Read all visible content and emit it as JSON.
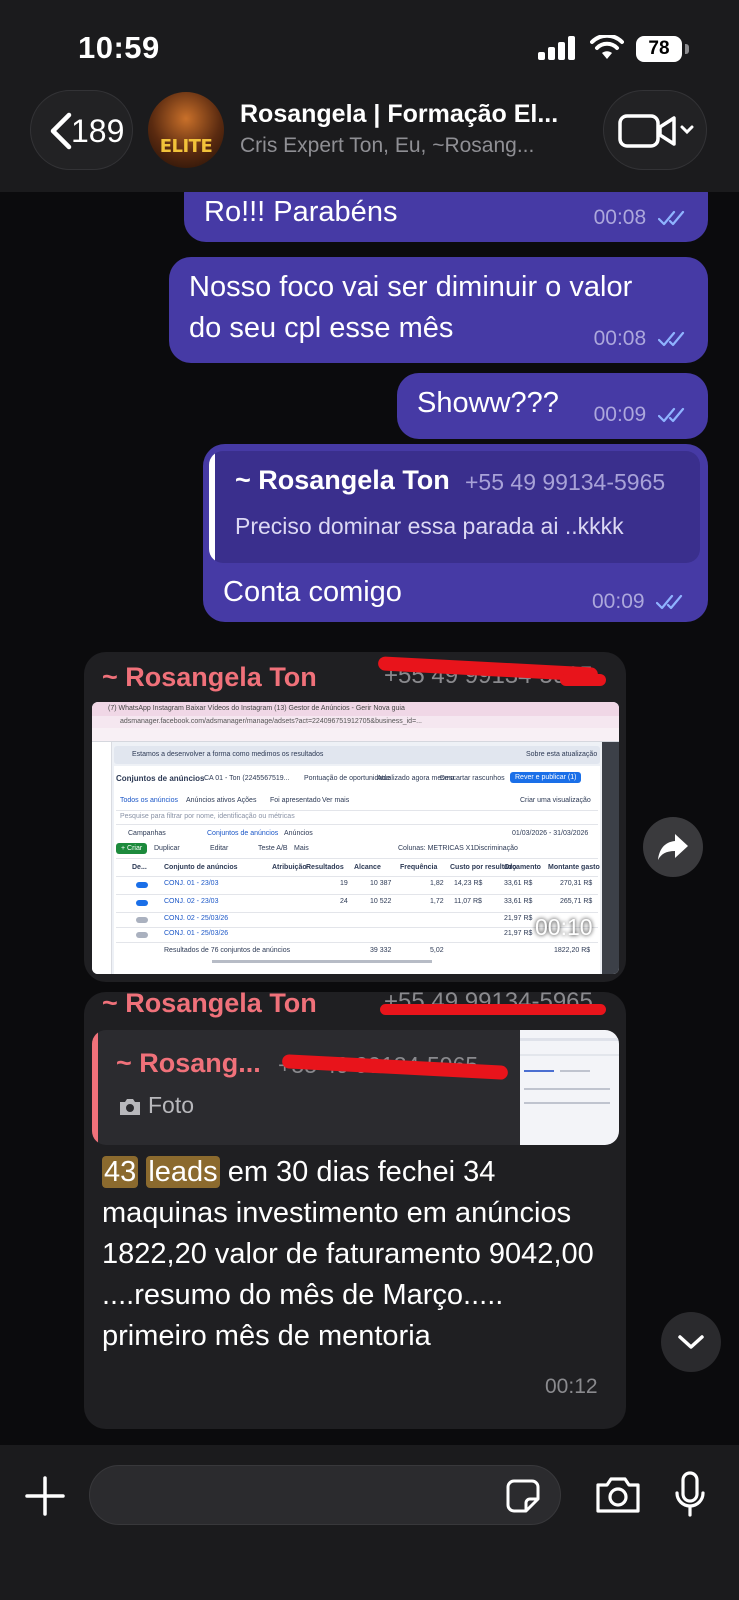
{
  "status_bar": {
    "time": "10:59",
    "battery": "78"
  },
  "header": {
    "back_count": "189",
    "title": "Rosangela | Formação El...",
    "subtitle": "Cris Expert Ton, Eu, ~Rosang...",
    "avatar_text": "ELITE"
  },
  "messages": [
    {
      "text": "Ro!!! Parabéns",
      "time": "00:08"
    },
    {
      "text": "Nosso foco vai ser diminuir o valor do seu cpl esse mês",
      "line1": "Nosso foco vai ser diminuir o valor",
      "line2": "do seu cpl esse mês",
      "time": "00:08"
    },
    {
      "text": "Showw???",
      "time": "00:09"
    },
    {
      "quote_name": "~ Rosangela Ton",
      "quote_phone": "+55 49 99134-5965",
      "quote_text": "Preciso dominar essa parada ai ..kkkk",
      "text": "Conta comigo",
      "time": "00:09"
    }
  ],
  "image_message": {
    "sender": "~ Rosangela Ton",
    "phone": "+55 49 99134-5965",
    "time": "00:10",
    "screenshot": {
      "tabs": "(7) WhatsApp   Instagram   Baixar Vídeos do Instagram   (13) Gestor de Anúncios - Gerir   Nova guia",
      "url": "adsmanager.facebook.com/adsmanager/manage/adsets?act=224096751912705&business_id=...",
      "notice": "Estamos a desenvolver a forma como medimos os resultados",
      "update_btn": "Sobre esta atualização",
      "page_title": "Conjuntos de anúncios",
      "account": "CA 01 - Ton (2245567519...",
      "optimization": "Pontuação de oportunidade",
      "updated": "Atualizado agora mesmo",
      "discard": "Descartar rascunhos",
      "review": "Rever e publicar (1)",
      "tab_all": "Todos os anúncios",
      "tab_active": "Anúncios ativos",
      "tab_actions": "Ações",
      "tab_published": "Foi apresentado",
      "see_more": "Ver mais",
      "create_view": "Criar uma visualização",
      "search_placeholder": "Pesquise para filtrar por nome, identificação ou métricas",
      "nav_campaigns": "Campanhas",
      "nav_adsets": "Conjuntos de anúncios",
      "nav_ads": "Anúncios",
      "date_range": "01/03/2026 - 31/03/2026",
      "create": "+ Criar",
      "duplicate": "Duplicar",
      "edit": "Editar",
      "ab_test": "Teste A/B",
      "more": "Mais",
      "columns": "Colunas: METRICAS X1",
      "breakdown": "Discriminação",
      "columns_headers": [
        "De...",
        "Conjunto de anúncios",
        "Atribuição",
        "Resultados",
        "Alcance",
        "Frequência",
        "Custo por resultado",
        "Orçamento",
        "Montante gasto"
      ],
      "rows": [
        {
          "name": "CONJ. 01 - 23/03",
          "results": "19",
          "reach": "10 387",
          "freq": "1,82",
          "cpr": "14,23 R$",
          "budget": "33,61 R$",
          "spent": "270,31 R$"
        },
        {
          "name": "CONJ. 02 - 23/03",
          "results": "24",
          "reach": "10 522",
          "freq": "1,72",
          "cpr": "11,07 R$",
          "budget": "33,61 R$",
          "spent": "265,71 R$"
        },
        {
          "name": "CONJ. 02 - 25/03/26",
          "results": "—",
          "reach": "—",
          "freq": "—",
          "cpr": "—",
          "budget": "21,97 R$",
          "spent": "—"
        },
        {
          "name": "CONJ. 01 - 25/03/26",
          "results": "—",
          "reach": "—",
          "freq": "—",
          "cpr": "—",
          "budget": "21,97 R$",
          "spent": "—"
        }
      ],
      "total_label": "Resultados de 76 conjuntos de anúncios",
      "total_reach": "39 332",
      "total_freq": "5,02",
      "total_spent": "1822,20 R$"
    }
  },
  "text_message": {
    "sender": "~ Rosangela Ton",
    "phone": "+55 49 99134-5965",
    "quote_name": "~ Rosang...",
    "quote_phone": "+55 49 99134-5965",
    "quote_type": "Foto",
    "highlight_1": "43",
    "highlight_2": "leads",
    "text_rest": " em 30 dias fechei 34 maquinas  investimento em anúncios 1822,20  valor de faturamento 9042,00 ....resumo do mês de Março..... primeiro mês de mentoria",
    "time": "00:12"
  },
  "input": {
    "placeholder": ""
  },
  "colors": {
    "outgoing_bubble": "#463aa5",
    "incoming_bubble": "#1f1f22",
    "sender_name": "#f0717a",
    "highlight": "#8b6a2e"
  }
}
